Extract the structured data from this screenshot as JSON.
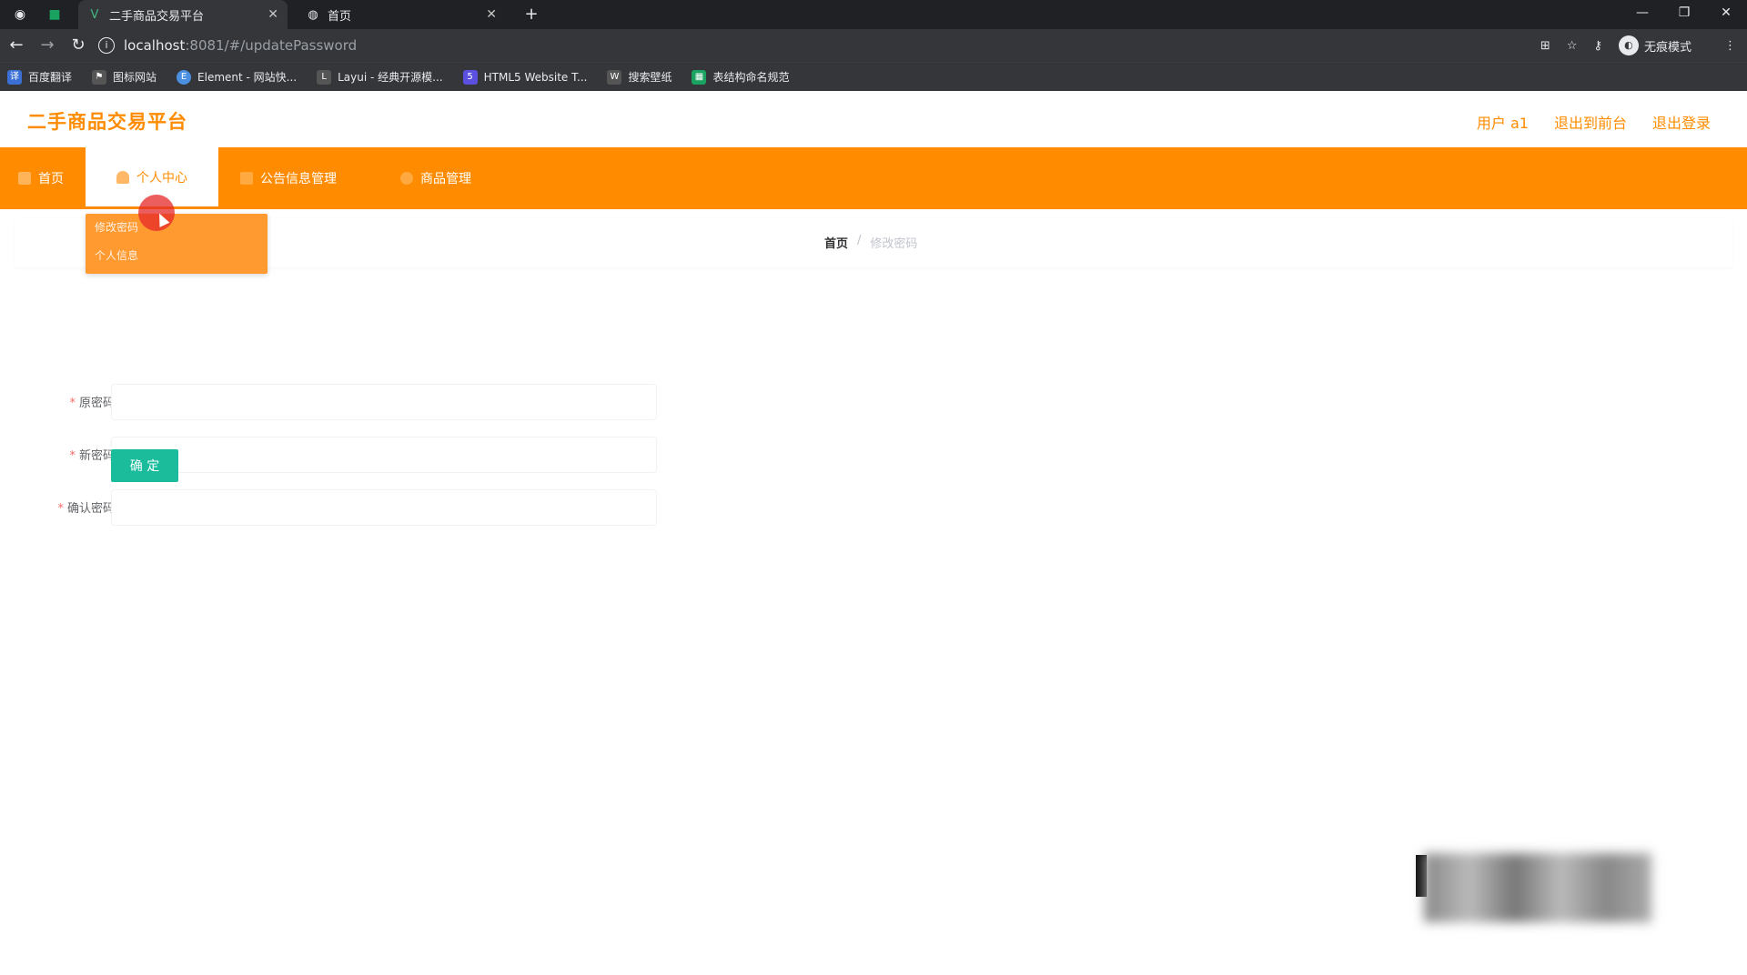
{
  "browser": {
    "tabs": [
      {
        "title": "二手商品交易平台",
        "active": true
      },
      {
        "title": "首页",
        "active": false
      }
    ],
    "new_tab": "+",
    "url_host": "localhost",
    "url_path": ":8081/#/updatePassword",
    "profile_label": "无痕模式",
    "bookmarks": [
      {
        "label": "百度翻译",
        "color": "#3b6fd6"
      },
      {
        "label": "图标网站",
        "color": "#555555"
      },
      {
        "label": "Element - 网站快...",
        "color": "#4a8fe0"
      },
      {
        "label": "Layui - 经典开源模...",
        "color": "#555555"
      },
      {
        "label": "HTML5 Website T...",
        "color": "#5b4fe0"
      },
      {
        "label": "搜索壁纸",
        "color": "#555555"
      },
      {
        "label": "表结构命名规范",
        "color": "#1aa260"
      }
    ]
  },
  "app": {
    "title": "二手商品交易平台",
    "header_links": [
      "用户 a1",
      "退出到前台",
      "退出登录"
    ],
    "nav": [
      {
        "label": "首页"
      },
      {
        "label": "个人中心"
      },
      {
        "label": "公告信息管理"
      },
      {
        "label": "商品管理"
      }
    ],
    "dropdown": [
      "修改密码",
      "个人信息"
    ],
    "breadcrumb": {
      "home": "首页",
      "separator": "/",
      "current": "修改密码"
    },
    "form": {
      "fields": [
        {
          "label": "原密码",
          "value": ""
        },
        {
          "label": "新密码",
          "value": ""
        },
        {
          "label": "确认密码",
          "value": ""
        }
      ],
      "required_mark": "*",
      "submit": "确 定"
    },
    "colors": {
      "primary": "#ff8c00",
      "button": "#1abc9c"
    }
  }
}
